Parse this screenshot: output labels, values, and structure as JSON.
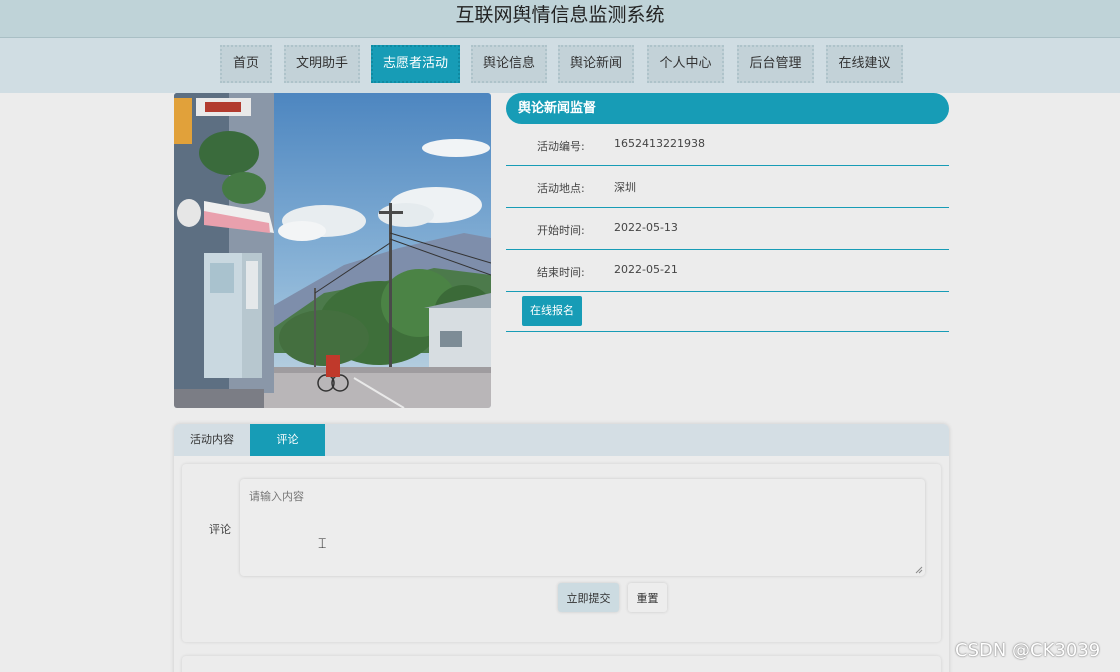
{
  "header": {
    "title": "互联网舆情信息监测系统"
  },
  "nav": {
    "items": [
      {
        "label": "首页"
      },
      {
        "label": "文明助手"
      },
      {
        "label": "志愿者活动"
      },
      {
        "label": "舆论信息"
      },
      {
        "label": "舆论新闻"
      },
      {
        "label": "个人中心"
      },
      {
        "label": "后台管理"
      },
      {
        "label": "在线建议"
      }
    ],
    "active_index": 2
  },
  "activity": {
    "title": "舆论新闻监督",
    "fields": [
      {
        "label": "活动编号:",
        "value": "1652413221938"
      },
      {
        "label": "活动地点:",
        "value": "深圳"
      },
      {
        "label": "开始时间:",
        "value": "2022-05-13"
      },
      {
        "label": "结束时间:",
        "value": "2022-05-21"
      }
    ],
    "signup_label": "在线报名"
  },
  "tabs": [
    {
      "label": "活动内容"
    },
    {
      "label": "评论"
    }
  ],
  "comment_form": {
    "label": "评论",
    "placeholder": "请输入内容",
    "submit_label": "立即提交",
    "reset_label": "重置"
  },
  "watermark": "CSDN @CK3039",
  "colors": {
    "accent": "#179cb6",
    "nav_bg": "#d0dde3",
    "title_bg": "#bfd3d8"
  }
}
